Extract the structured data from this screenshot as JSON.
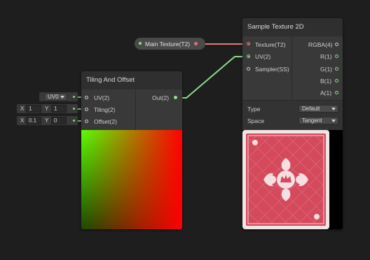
{
  "property_pill": {
    "label": "Main Texture(T2)"
  },
  "tiling_node": {
    "title": "Tiling And Offset",
    "inputs": [
      "UV(2)",
      "Tiling(2)",
      "Offset(2)"
    ],
    "output": "Out(2)",
    "uv_dropdown": "UV0",
    "tiling": {
      "x_label": "X",
      "x": "1",
      "y_label": "Y",
      "y": "1"
    },
    "offset": {
      "x_label": "X",
      "x": "0.1",
      "y_label": "Y",
      "y": "0"
    }
  },
  "sample_node": {
    "title": "Sample Texture 2D",
    "inputs": [
      "Texture(T2)",
      "UV(2)",
      "Sampler(SS)"
    ],
    "outputs": [
      "RGBA(4)",
      "R(1)",
      "G(1)",
      "B(1)",
      "A(1)"
    ],
    "type_label": "Type",
    "type_value": "Default",
    "space_label": "Space",
    "space_value": "Tangent"
  },
  "colors": {
    "background": "#1e1e1e",
    "node_body": "#393939",
    "node_header": "#2f2f2f",
    "wire_green": "#8fd88f",
    "wire_red": "#e07a7a",
    "card_red": "#d44a5c"
  }
}
